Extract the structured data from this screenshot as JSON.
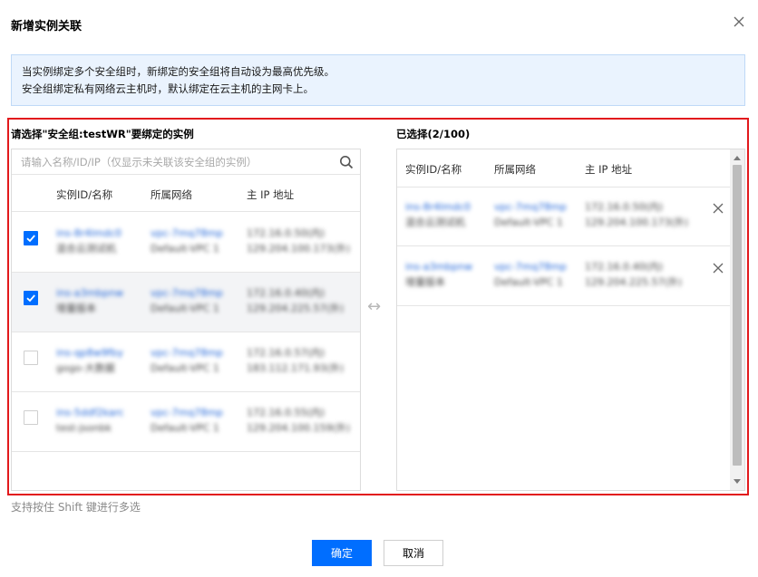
{
  "dialog": {
    "title": "新增实例关联",
    "notice_line1": "当实例绑定多个安全组时，新绑定的安全组将自动设为最高优先级。",
    "notice_line2": "安全组绑定私有网络云主机时，默认绑定在云主机的主网卡上。"
  },
  "left": {
    "title": "请选择\"安全组:testWR\"要绑定的实例",
    "search_placeholder": "请输入名称/ID/IP（仅显示未关联该安全组的实例）",
    "columns": [
      "实例ID/名称",
      "所属网络",
      "主 IP 地址"
    ],
    "rows": [
      {
        "checked": true,
        "id": "ins-8r4lmdc0",
        "name": "混合云测试机",
        "vpc": "vpc-7mq78mp",
        "vpc_name": "Default-VPC 1",
        "ip1": "172.16.0.50(内)",
        "ip2": "129.204.100.173(外)"
      },
      {
        "checked": true,
        "id": "ins-a3mbpnw",
        "name": "增量版本",
        "vpc": "vpc-7mq78mp",
        "vpc_name": "Default-VPC 1",
        "ip1": "172.16.0.40(内)",
        "ip2": "129.204.225.57(外)"
      },
      {
        "checked": false,
        "id": "ins-qp8w9fby",
        "name": "gogo-大数据",
        "vpc": "vpc-7mq78mp",
        "vpc_name": "Default-VPC 1",
        "ip1": "172.16.0.57(内)",
        "ip2": "183.112.171.93(外)"
      },
      {
        "checked": false,
        "id": "ins-5ddf2karc",
        "name": "test-jsonbk",
        "vpc": "vpc-7mq78mp",
        "vpc_name": "Default-VPC 1",
        "ip1": "172.16.0.55(内)",
        "ip2": "129.204.100.159(外)"
      }
    ]
  },
  "transfer_icon": "↔",
  "right": {
    "title": "已选择(2/100)",
    "columns": [
      "实例ID/名称",
      "所属网络",
      "主 IP 地址"
    ],
    "rows": [
      {
        "id": "ins-8r4lmdc0",
        "name": "混合云测试机",
        "vpc": "vpc-7mq78mp",
        "vpc_name": "Default-VPC 1",
        "ip1": "172.16.0.50(内)",
        "ip2": "129.204.100.173(外)"
      },
      {
        "id": "ins-a3mbpnw",
        "name": "增量版本",
        "vpc": "vpc-7mq78mp",
        "vpc_name": "Default-VPC 1",
        "ip1": "172.16.0.40(内)",
        "ip2": "129.204.225.57(外)"
      }
    ]
  },
  "hint": "支持按住 Shift 键进行多选",
  "buttons": {
    "ok": "确定",
    "cancel": "取消"
  },
  "colors": {
    "primary": "#006eff",
    "highlight_border": "#e2191c",
    "notice_bg": "#eaf3fe",
    "link": "#1d63d8"
  }
}
